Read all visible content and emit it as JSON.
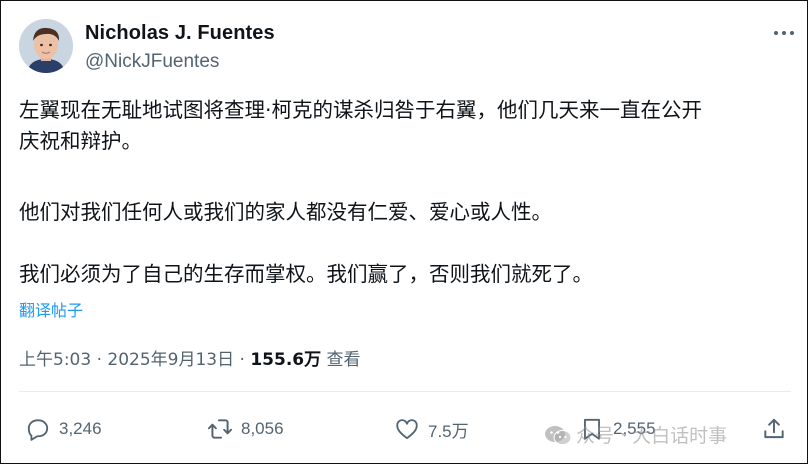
{
  "author": {
    "name": "Nicholas J. Fuentes",
    "handle": "@NickJFuentes"
  },
  "post": {
    "paragraph_1_line_1": "左翼现在无耻地试图将查理·柯克的谋杀归咎于右翼，他们几天来一直在公开",
    "paragraph_1_line_2": "庆祝和辩护。",
    "paragraph_2": "他们对我们任何人或我们的家人都没有仁爱、爱心或人性。",
    "paragraph_3": "我们必须为了自己的生存而掌权。我们赢了，否则我们就死了。",
    "translate_label": "翻译帖子"
  },
  "meta": {
    "time": "上午5:03",
    "separator": "·",
    "date": "2025年9月13日",
    "views_count": "155.6万",
    "views_label": "查看"
  },
  "actions": {
    "replies": "3,246",
    "reposts": "8,056",
    "likes": "7.5万",
    "bookmarks": "2,555"
  },
  "watermark": {
    "account": "众号",
    "separator": "·",
    "name": "大白话时事"
  },
  "colors": {
    "text": "#0f1419",
    "secondary": "#536471",
    "link": "#1d9bf0"
  },
  "icons": [
    "more-icon",
    "reply-icon",
    "repost-icon",
    "like-icon",
    "bookmark-icon",
    "share-icon",
    "wechat-icon"
  ]
}
